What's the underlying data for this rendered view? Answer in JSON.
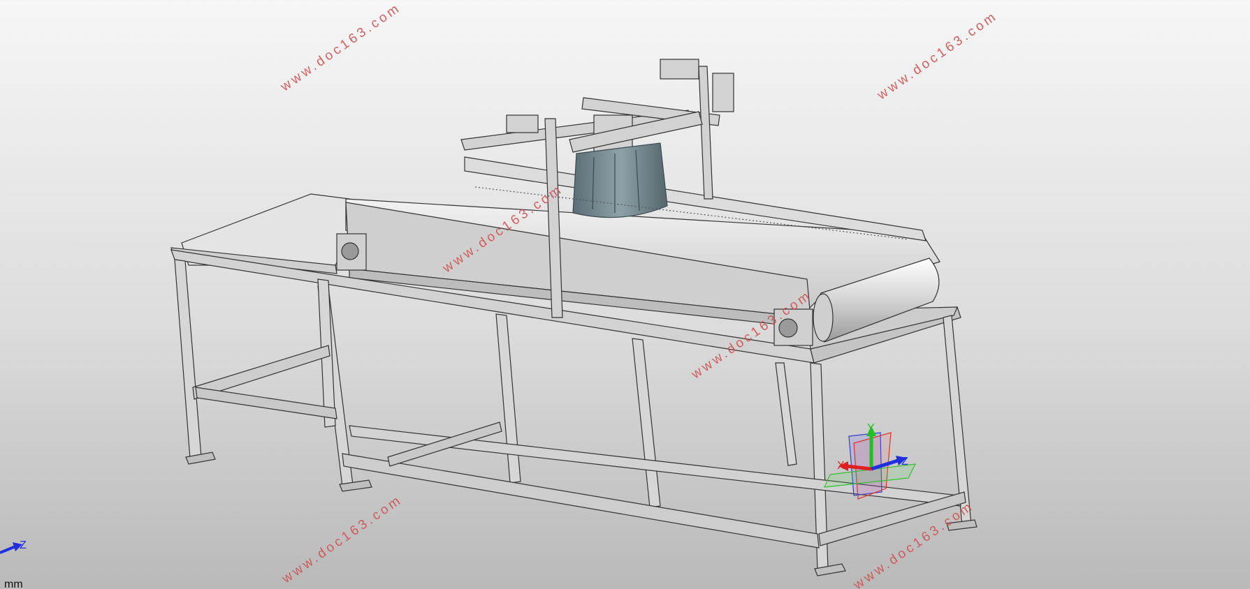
{
  "watermark": {
    "text": "www.doc163.com",
    "color": "#d05050"
  },
  "triad": {
    "x_label": "X",
    "y_label": "Y",
    "z_label": "Z",
    "x_color": "#e02020",
    "y_color": "#20c020",
    "z_color": "#2030e0"
  },
  "corner_axis": {
    "z_label": "Z"
  },
  "status": {
    "units": "mm"
  },
  "icons": [
    "coordinate-triad-icon",
    "view-axis-icon"
  ]
}
